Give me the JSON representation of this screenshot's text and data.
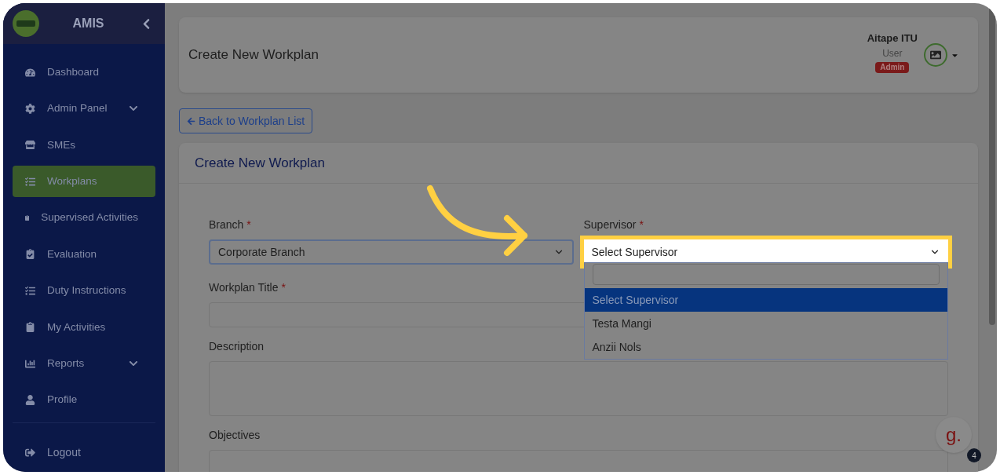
{
  "sidebar": {
    "brand": "AMIS",
    "items": [
      {
        "label": "Dashboard",
        "selected": false,
        "expandable": false
      },
      {
        "label": "Admin Panel",
        "selected": false,
        "expandable": true
      },
      {
        "label": "SMEs",
        "selected": false,
        "expandable": false
      },
      {
        "label": "Workplans",
        "selected": true,
        "expandable": false
      },
      {
        "label": "Supervised Activities",
        "selected": false,
        "expandable": false
      },
      {
        "label": "Evaluation",
        "selected": false,
        "expandable": false
      },
      {
        "label": "Duty Instructions",
        "selected": false,
        "expandable": false
      },
      {
        "label": "My Activities",
        "selected": false,
        "expandable": false
      },
      {
        "label": "Reports",
        "selected": false,
        "expandable": true
      },
      {
        "label": "Profile",
        "selected": false,
        "expandable": false
      }
    ],
    "footer_item": {
      "label": "Logout"
    }
  },
  "header": {
    "title": "Create New Workplan",
    "user": {
      "name": "Aitape ITU",
      "role": "User",
      "badge": "Admin"
    }
  },
  "back_button": "Back to Workplan List",
  "form": {
    "title": "Create New Workplan",
    "branch": {
      "label": "Branch",
      "required_mark": "*",
      "value": "Corporate Branch"
    },
    "supervisor": {
      "label": "Supervisor",
      "required_mark": "*",
      "value": "Select Supervisor",
      "expanded": true,
      "options": [
        {
          "label": "Select Supervisor",
          "selected": true
        },
        {
          "label": "Testa Mangi",
          "selected": false
        },
        {
          "label": "Anzii Nols",
          "selected": false
        }
      ]
    },
    "workplan_title": {
      "label": "Workplan Title",
      "required_mark": "*"
    },
    "description": {
      "label": "Description"
    },
    "objectives": {
      "label": "Objectives"
    }
  },
  "help_badge": {
    "letter": "g.",
    "count": "4"
  }
}
